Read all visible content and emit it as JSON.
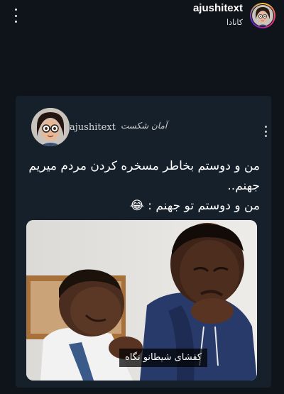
{
  "header": {
    "username": "ajushitext",
    "location": "کانادا",
    "menu_icon": "more-vert-icon"
  },
  "post": {
    "username": "ajushitext",
    "signature": "آمان شکست",
    "menu_icon": "more-vert-icon",
    "text_lines": [
      "من و دوستم بخاطر مسخره کردن مردم میریم",
      "جهنم..",
      "من و دوستم تو جهنم : 😂"
    ],
    "image_caption": "کفشای شیطانو نگاه"
  },
  "colors": {
    "background": "#0f131a",
    "card": "#15202b",
    "text": "#ffffff"
  }
}
